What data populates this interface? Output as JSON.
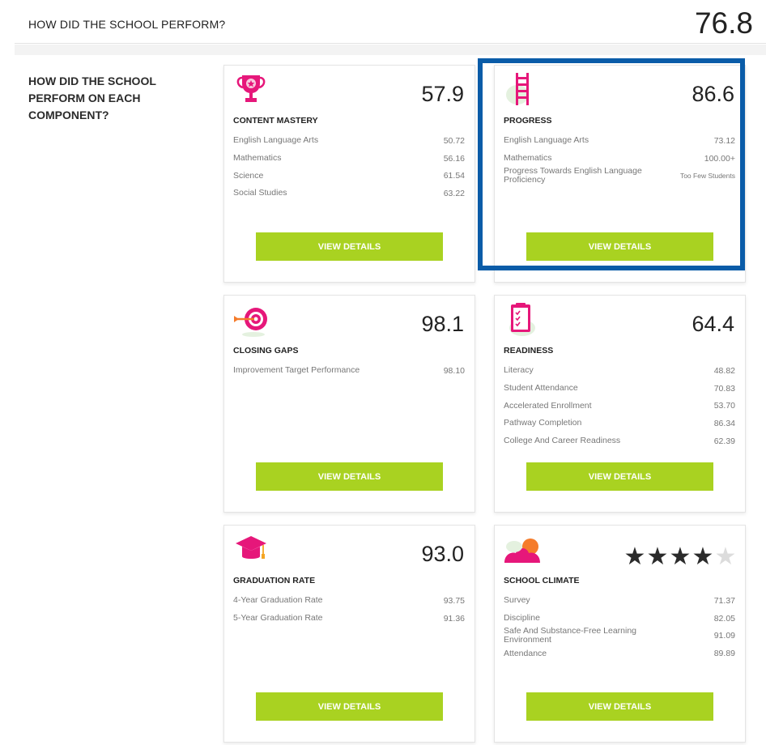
{
  "header": {
    "title": "HOW DID THE SCHOOL PERFORM?",
    "score": "76.8"
  },
  "sidebar": {
    "question": "HOW DID THE SCHOOL PERFORM ON EACH COMPONENT?"
  },
  "colors": {
    "accent_green": "#a9d221",
    "icon_pink": "#e6177a",
    "highlight_blue": "#0a5ca8"
  },
  "cards": [
    {
      "icon": "trophy-icon",
      "title": "CONTENT MASTERY",
      "score": "57.9",
      "rows": [
        {
          "label": "English Language Arts",
          "value": "50.72"
        },
        {
          "label": "Mathematics",
          "value": "56.16"
        },
        {
          "label": "Science",
          "value": "61.54"
        },
        {
          "label": "Social Studies",
          "value": "63.22"
        }
      ],
      "button": "VIEW DETAILS"
    },
    {
      "icon": "ladder-icon",
      "title": "PROGRESS",
      "score": "86.6",
      "rows": [
        {
          "label": "English Language Arts",
          "value": "73.12"
        },
        {
          "label": "Mathematics",
          "value": "100.00+"
        },
        {
          "label": "Progress Towards English Language Proficiency",
          "value": "Too Few Students"
        }
      ],
      "button": "VIEW DETAILS"
    },
    {
      "icon": "target-icon",
      "title": "CLOSING GAPS",
      "score": "98.1",
      "rows": [
        {
          "label": "Improvement Target Performance",
          "value": "98.10"
        }
      ],
      "button": "VIEW DETAILS"
    },
    {
      "icon": "clipboard-icon",
      "title": "READINESS",
      "score": "64.4",
      "rows": [
        {
          "label": "Literacy",
          "value": "48.82"
        },
        {
          "label": "Student Attendance",
          "value": "70.83"
        },
        {
          "label": "Accelerated Enrollment",
          "value": "53.70"
        },
        {
          "label": "Pathway Completion",
          "value": "86.34"
        },
        {
          "label": "College And Career Readiness",
          "value": "62.39"
        }
      ],
      "button": "VIEW DETAILS"
    },
    {
      "icon": "graduation-cap-icon",
      "title": "GRADUATION RATE",
      "score": "93.0",
      "rows": [
        {
          "label": "4-Year Graduation Rate",
          "value": "93.75"
        },
        {
          "label": "5-Year Graduation Rate",
          "value": "91.36"
        }
      ],
      "button": "VIEW DETAILS"
    },
    {
      "icon": "sun-cloud-icon",
      "title": "SCHOOL CLIMATE",
      "rating_stars": 4,
      "rating_max": 5,
      "rows": [
        {
          "label": "Survey",
          "value": "71.37"
        },
        {
          "label": "Discipline",
          "value": "82.05"
        },
        {
          "label": "Safe And Substance-Free Learning Environment",
          "value": "91.09"
        },
        {
          "label": "Attendance",
          "value": "89.89"
        }
      ],
      "button": "VIEW DETAILS"
    }
  ]
}
